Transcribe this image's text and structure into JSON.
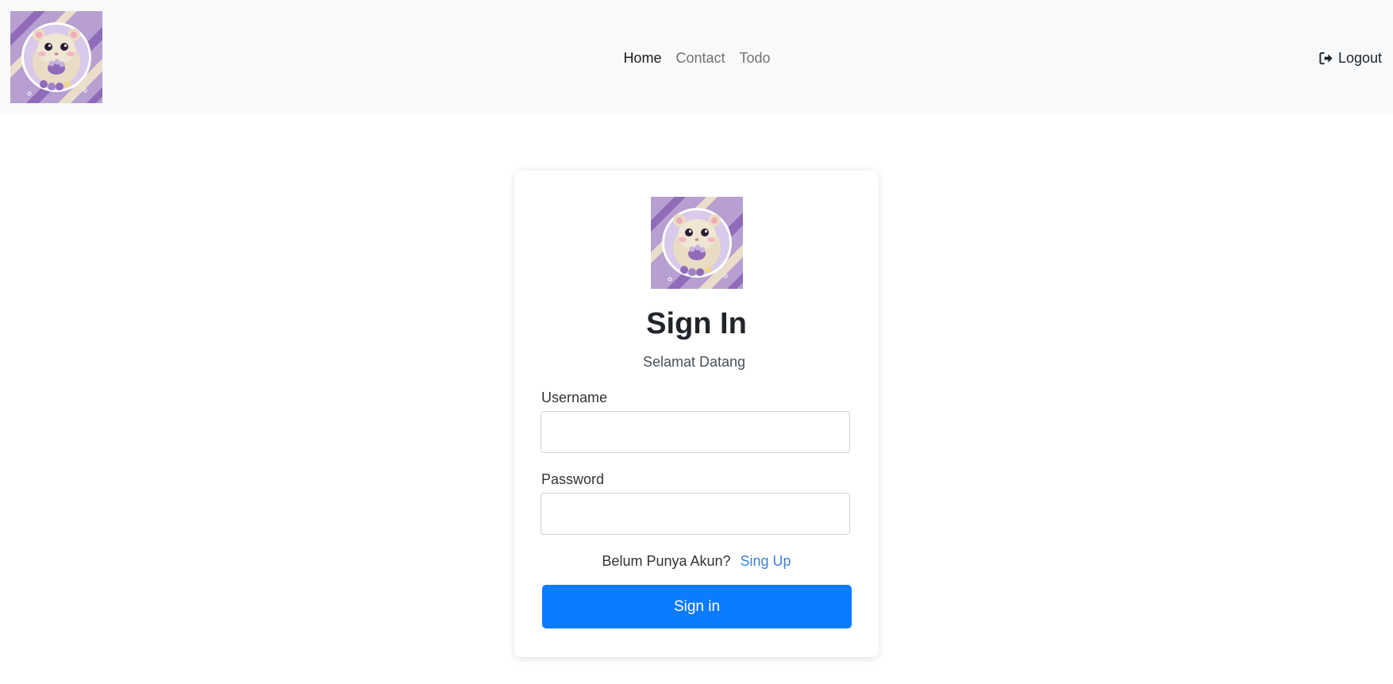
{
  "navbar": {
    "logo_alt": "hamster-logo",
    "links": [
      {
        "label": "Home"
      },
      {
        "label": "Contact"
      },
      {
        "label": "Todo"
      }
    ],
    "logout_label": "Logout"
  },
  "card": {
    "title": "Sign In",
    "subtitle": "Selamat Datang",
    "username_label": "Username",
    "username_value": "",
    "password_label": "Password",
    "password_value": "",
    "signup_prompt": "Belum Punya Akun?",
    "signup_link": "Sing Up",
    "submit_label": "Sign in"
  },
  "colors": {
    "navbar_bg": "#f8f9fa",
    "primary": "#0b7bff",
    "link": "#3b82d6"
  }
}
